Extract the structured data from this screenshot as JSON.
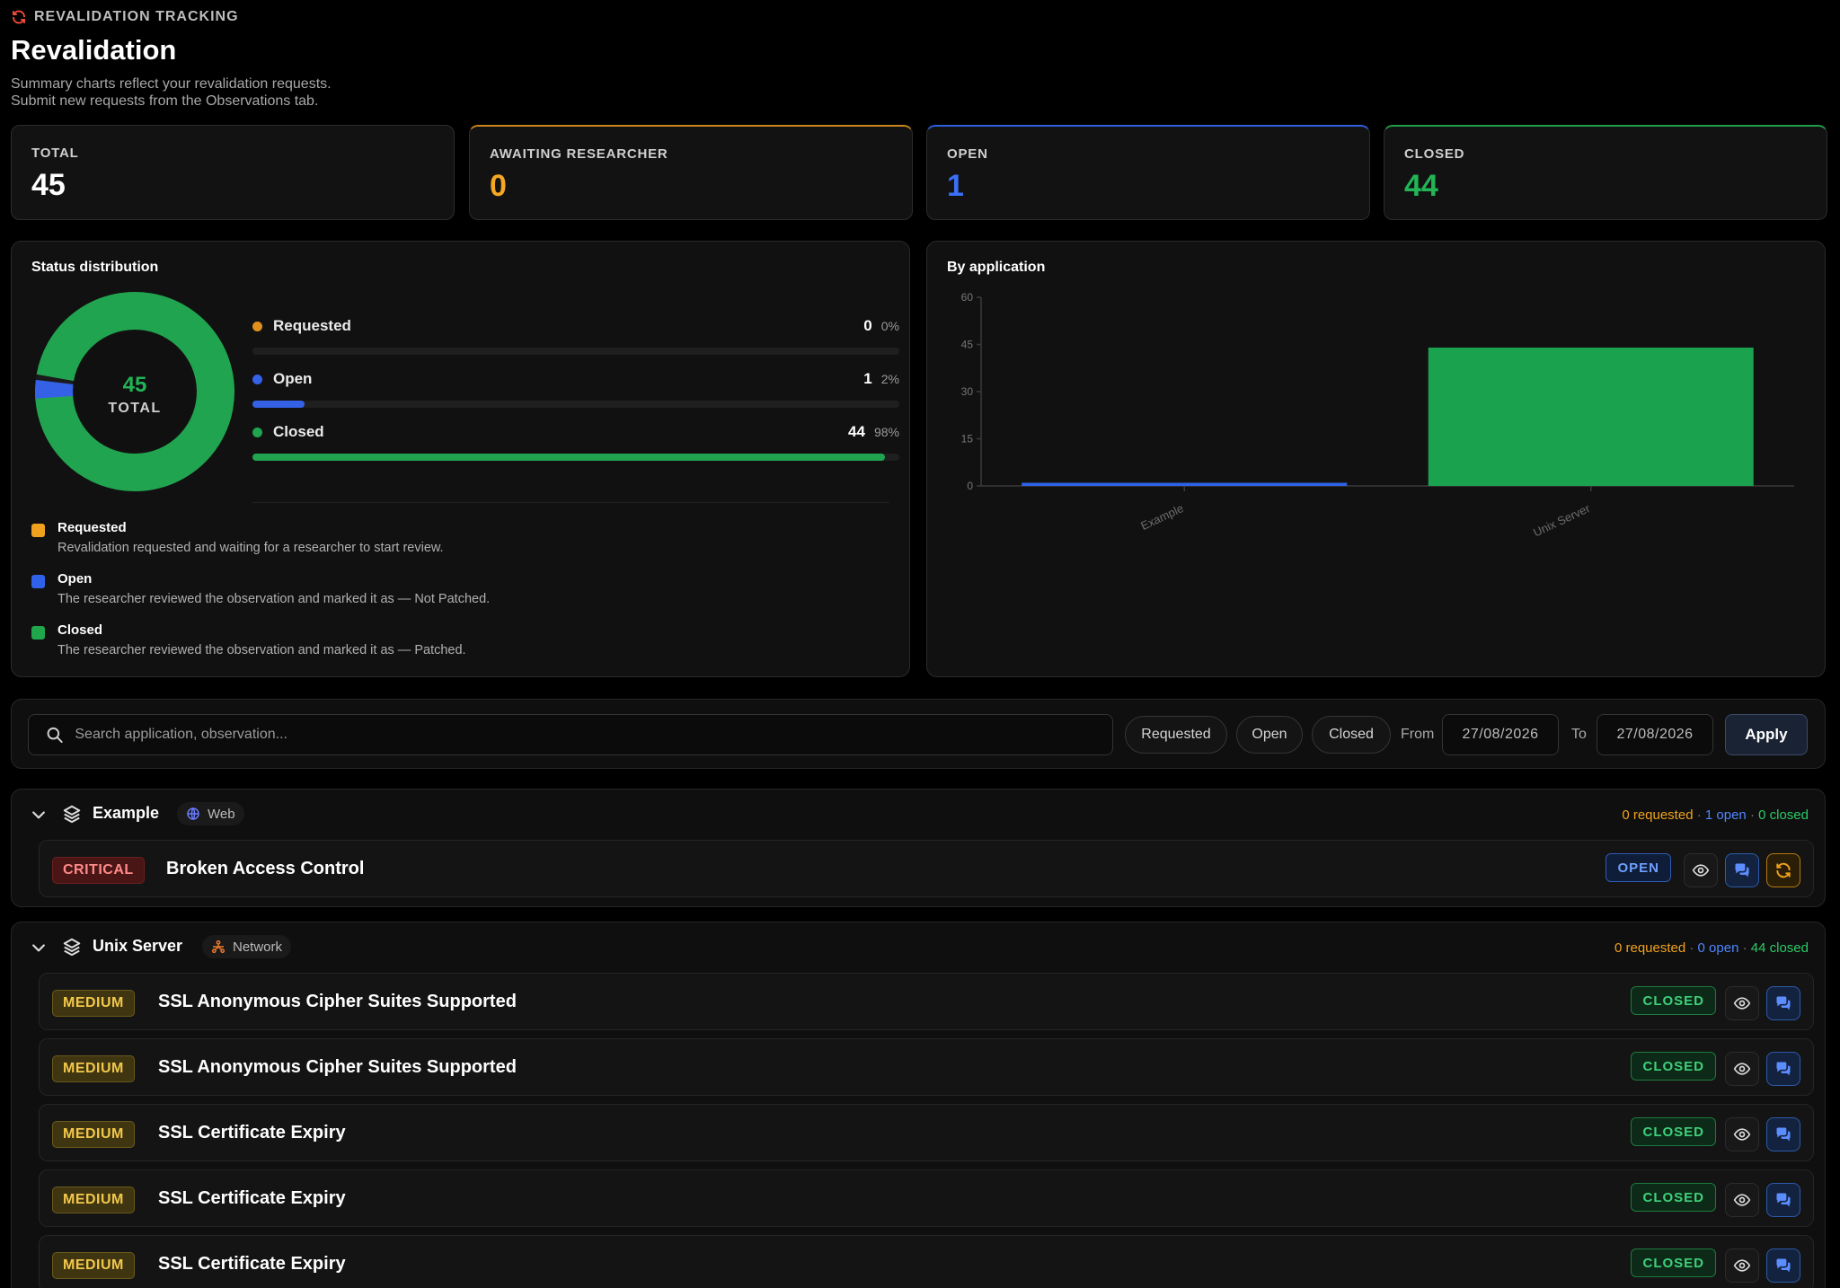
{
  "header": {
    "eyebrow": "REVALIDATION TRACKING",
    "title": "Revalidation",
    "subtitle_line1": "Summary charts reflect your revalidation requests.",
    "subtitle_line2": "Submit new requests from the Observations tab."
  },
  "stats": [
    {
      "label": "TOTAL",
      "value": "45",
      "color": "#ffffff",
      "accent": "#2c2c2c"
    },
    {
      "label": "AWAITING RESEARCHER",
      "value": "0",
      "color": "#f5a623",
      "accent": "#c9861d"
    },
    {
      "label": "OPEN",
      "value": "1",
      "color": "#3b6ff5",
      "accent": "#2f5fe0"
    },
    {
      "label": "CLOSED",
      "value": "44",
      "color": "#22b455",
      "accent": "#1f9e4b"
    }
  ],
  "status_distribution": {
    "title": "Status distribution",
    "total_value": "45",
    "total_label": "TOTAL",
    "items": [
      {
        "name": "Requested",
        "count": "0",
        "pct": "0%",
        "fraction": 0.0,
        "color": "#e0901c"
      },
      {
        "name": "Open",
        "count": "1",
        "pct": "2%",
        "fraction": 0.022,
        "color": "#3461e6"
      },
      {
        "name": "Closed",
        "count": "44",
        "pct": "98%",
        "fraction": 0.978,
        "color": "#21a44f"
      }
    ],
    "descriptions": [
      {
        "title": "Requested",
        "text": "Revalidation requested and waiting for a researcher to start review.",
        "color": "#f0a21e"
      },
      {
        "title": "Open",
        "text": "The researcher reviewed the observation and marked it as — Not Patched.",
        "color": "#2f62e8"
      },
      {
        "title": "Closed",
        "text": "The researcher reviewed the observation and marked it as — Patched.",
        "color": "#20a64d"
      }
    ]
  },
  "chart_data": {
    "type": "bar",
    "title": "By application",
    "categories": [
      "Example",
      "Unix Server"
    ],
    "series": [
      {
        "values": [
          1,
          44
        ],
        "colors": [
          "#2f62e8",
          "#1aa24e"
        ]
      }
    ],
    "yticks": [
      "0",
      "15",
      "30",
      "45",
      "60"
    ],
    "ylim": [
      0,
      60
    ],
    "xlabel": "",
    "ylabel": "",
    "grid": false
  },
  "filters": {
    "search_placeholder": "Search application, observation...",
    "chips": [
      "Requested",
      "Open",
      "Closed"
    ],
    "from_label": "From",
    "from_value": "27/08/2026",
    "to_label": "To",
    "to_value": "27/08/2026",
    "apply_label": "Apply"
  },
  "groups": [
    {
      "name": "Example",
      "tag": "Web",
      "stats": {
        "requested": "0 requested",
        "open": "1 open",
        "closed": "0 closed"
      },
      "rows": [
        {
          "severity": "CRITICAL",
          "title": "Broken Access Control",
          "status": "OPEN"
        }
      ]
    },
    {
      "name": "Unix Server",
      "tag": "Network",
      "stats": {
        "requested": "0 requested",
        "open": "0 open",
        "closed": "44 closed"
      },
      "rows": [
        {
          "severity": "MEDIUM",
          "title": "SSL Anonymous Cipher Suites Supported",
          "status": "CLOSED"
        },
        {
          "severity": "MEDIUM",
          "title": "SSL Anonymous Cipher Suites Supported",
          "status": "CLOSED"
        },
        {
          "severity": "MEDIUM",
          "title": "SSL Certificate Expiry",
          "status": "CLOSED"
        },
        {
          "severity": "MEDIUM",
          "title": "SSL Certificate Expiry",
          "status": "CLOSED"
        },
        {
          "severity": "MEDIUM",
          "title": "SSL Certificate Expiry",
          "status": "CLOSED"
        }
      ]
    }
  ],
  "stat_separator": " · ",
  "colors": {
    "requested": "#f0a21e",
    "open": "#4f86ff",
    "closed": "#2ccb66"
  }
}
